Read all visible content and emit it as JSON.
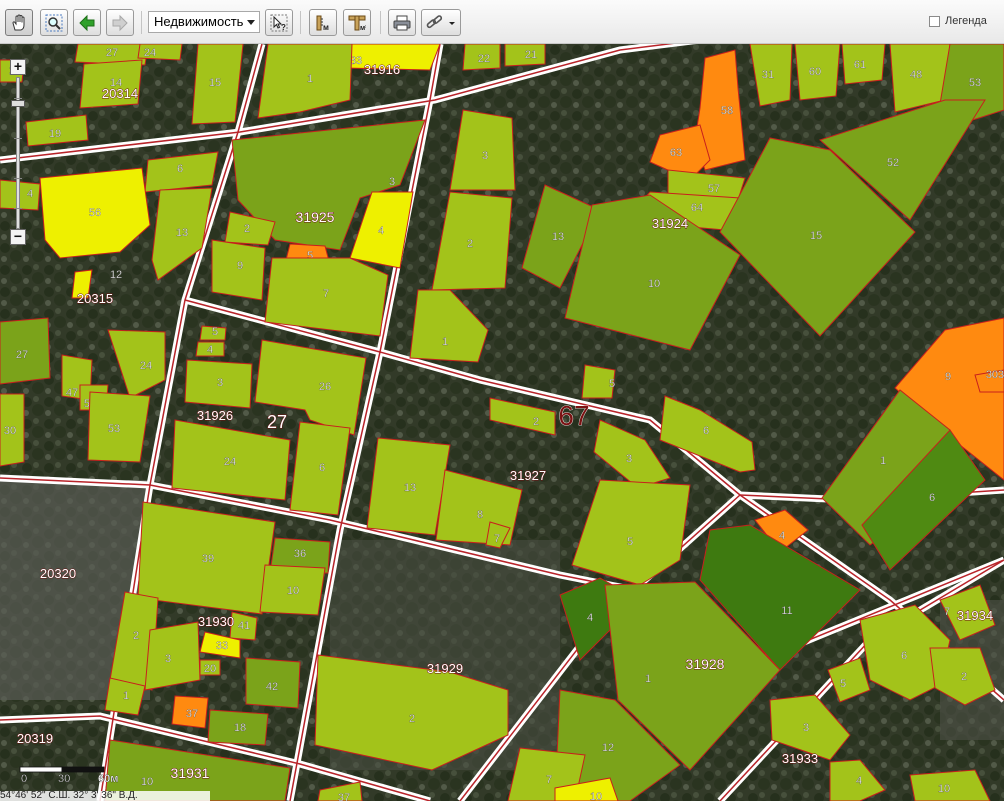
{
  "toolbar": {
    "layer_select": "Недвижимость",
    "legend_label": "Легенда"
  },
  "scale": {
    "zero": "0",
    "mid": "30",
    "end": "60м"
  },
  "coords": "54°46' 52\" С.Ш.   32° 3' 36\" В.Д.",
  "colors": {
    "light": "#a3c31a",
    "mid": "#7ba31a",
    "dark": "#4f8a12",
    "darker": "#3e7a10",
    "yellow": "#eef000",
    "orange": "#ff8a10",
    "outline": "#c8201c"
  },
  "blocks": [
    {
      "label": "20314"
    },
    {
      "label": "31916"
    },
    {
      "label": "20315"
    },
    {
      "label": "31925"
    },
    {
      "label": "31924"
    },
    {
      "label": "31926"
    },
    {
      "label": "27"
    },
    {
      "label": "67"
    },
    {
      "label": "31927"
    },
    {
      "label": "20320"
    },
    {
      "label": "31930"
    },
    {
      "label": "31929"
    },
    {
      "label": "31928"
    },
    {
      "label": "31934"
    },
    {
      "label": "20319"
    },
    {
      "label": "31931"
    },
    {
      "label": "31933"
    }
  ],
  "parcels": [
    {
      "label": "27",
      "tone": "light"
    },
    {
      "label": "24",
      "tone": "light"
    },
    {
      "label": "14",
      "tone": "light"
    },
    {
      "label": "15",
      "tone": "light"
    },
    {
      "label": "19",
      "tone": "light"
    },
    {
      "label": "2",
      "tone": "light"
    },
    {
      "label": "83",
      "tone": "yellow"
    },
    {
      "label": "1",
      "tone": "light"
    },
    {
      "label": "22",
      "tone": "light"
    },
    {
      "label": "21",
      "tone": "light"
    },
    {
      "label": "58",
      "tone": "orange"
    },
    {
      "label": "63",
      "tone": "orange"
    },
    {
      "label": "31",
      "tone": "light"
    },
    {
      "label": "60",
      "tone": "light"
    },
    {
      "label": "61",
      "tone": "light"
    },
    {
      "label": "48",
      "tone": "light"
    },
    {
      "label": "53",
      "tone": "mid"
    },
    {
      "label": "52",
      "tone": "mid"
    },
    {
      "label": "6",
      "tone": "light"
    },
    {
      "label": "4",
      "tone": "light"
    },
    {
      "label": "56",
      "tone": "yellow"
    },
    {
      "label": "13",
      "tone": "light"
    },
    {
      "label": "3",
      "tone": "mid"
    },
    {
      "label": "4",
      "tone": "yellow"
    },
    {
      "label": "2",
      "tone": "light"
    },
    {
      "label": "9",
      "tone": "light"
    },
    {
      "label": "5",
      "tone": "orange"
    },
    {
      "label": "7",
      "tone": "light"
    },
    {
      "label": "12",
      "tone": "yellow"
    },
    {
      "label": "3",
      "tone": "light"
    },
    {
      "label": "2",
      "tone": "light"
    },
    {
      "label": "1",
      "tone": "light"
    },
    {
      "label": "13",
      "tone": "mid"
    },
    {
      "label": "57",
      "tone": "light"
    },
    {
      "label": "64",
      "tone": "light"
    },
    {
      "label": "10",
      "tone": "mid"
    },
    {
      "label": "15",
      "tone": "mid"
    },
    {
      "label": "27",
      "tone": "mid"
    },
    {
      "label": "24",
      "tone": "light"
    },
    {
      "label": "47",
      "tone": "light"
    },
    {
      "label": "50",
      "tone": "light"
    },
    {
      "label": "53",
      "tone": "light"
    },
    {
      "label": "30",
      "tone": "light"
    },
    {
      "label": "5",
      "tone": "light"
    },
    {
      "label": "4",
      "tone": "light"
    },
    {
      "label": "3",
      "tone": "light"
    },
    {
      "label": "26",
      "tone": "light"
    },
    {
      "label": "24",
      "tone": "light"
    },
    {
      "label": "6",
      "tone": "light"
    },
    {
      "label": "5",
      "tone": "light"
    },
    {
      "label": "2",
      "tone": "light"
    },
    {
      "label": "3",
      "tone": "light"
    },
    {
      "label": "6",
      "tone": "light"
    },
    {
      "label": "9",
      "tone": "orange"
    },
    {
      "label": "303",
      "tone": "orange"
    },
    {
      "label": "1",
      "tone": "mid"
    },
    {
      "label": "6",
      "tone": "dark"
    },
    {
      "label": "13",
      "tone": "light"
    },
    {
      "label": "8",
      "tone": "light"
    },
    {
      "label": "7",
      "tone": "light"
    },
    {
      "label": "5",
      "tone": "light"
    },
    {
      "label": "4",
      "tone": "orange"
    },
    {
      "label": "11",
      "tone": "darker"
    },
    {
      "label": "4",
      "tone": "darker"
    },
    {
      "label": "39",
      "tone": "light"
    },
    {
      "label": "36",
      "tone": "mid"
    },
    {
      "label": "10",
      "tone": "light"
    },
    {
      "label": "2",
      "tone": "light"
    },
    {
      "label": "3",
      "tone": "light"
    },
    {
      "label": "41",
      "tone": "light"
    },
    {
      "label": "33",
      "tone": "yellow"
    },
    {
      "label": "20",
      "tone": "light"
    },
    {
      "label": "42",
      "tone": "mid"
    },
    {
      "label": "1",
      "tone": "light"
    },
    {
      "label": "37",
      "tone": "orange"
    },
    {
      "label": "18",
      "tone": "mid"
    },
    {
      "label": "2",
      "tone": "light"
    },
    {
      "label": "1",
      "tone": "mid"
    },
    {
      "label": "12",
      "tone": "mid"
    },
    {
      "label": "7",
      "tone": "light"
    },
    {
      "label": "10",
      "tone": "yellow"
    },
    {
      "label": "3",
      "tone": "light"
    },
    {
      "label": "4",
      "tone": "light"
    },
    {
      "label": "10",
      "tone": "light"
    },
    {
      "label": "6",
      "tone": "light"
    },
    {
      "label": "2",
      "tone": "light"
    },
    {
      "label": "5",
      "tone": "light"
    },
    {
      "label": "7",
      "tone": "light"
    },
    {
      "label": "10",
      "tone": "mid"
    },
    {
      "label": "37",
      "tone": "light"
    }
  ]
}
